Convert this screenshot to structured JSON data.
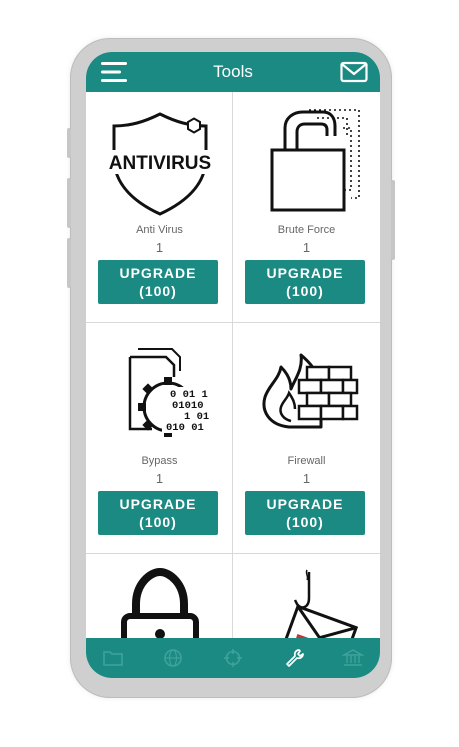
{
  "header": {
    "title": "Tools",
    "menu_icon": "hamburger-menu-icon",
    "mail_icon": "mail-icon"
  },
  "colors": {
    "accent": "#1a8a82",
    "nav_icon_inactive": "#3fa39b",
    "nav_icon_active": "#ffffff"
  },
  "tools": [
    {
      "name": "Anti Virus",
      "level": "1",
      "upgrade_line1": "UPGRADE",
      "upgrade_line2": "(100)",
      "icon": "antivirus-shield-icon",
      "icon_text": "ANTIVIRUS"
    },
    {
      "name": "Brute Force",
      "level": "1",
      "upgrade_line1": "UPGRADE",
      "upgrade_line2": "(100)",
      "icon": "brute-force-padlock-icon"
    },
    {
      "name": "Bypass",
      "level": "1",
      "upgrade_line1": "UPGRADE",
      "upgrade_line2": "(100)",
      "icon": "bypass-binary-gear-icon",
      "icon_text": [
        "0 01 1",
        "01010",
        "1 01",
        "010 01"
      ]
    },
    {
      "name": "Firewall",
      "level": "1",
      "upgrade_line1": "UPGRADE",
      "upgrade_line2": "(100)",
      "icon": "firewall-icon"
    },
    {
      "icon": "padlock-icon"
    },
    {
      "icon": "phishing-hook-icon"
    }
  ],
  "bottom_nav": [
    {
      "icon": "folder-icon",
      "active": false
    },
    {
      "icon": "globe-icon",
      "active": false
    },
    {
      "icon": "crosshair-icon",
      "active": false
    },
    {
      "icon": "wrench-icon",
      "active": true
    },
    {
      "icon": "bank-icon",
      "active": false
    }
  ]
}
